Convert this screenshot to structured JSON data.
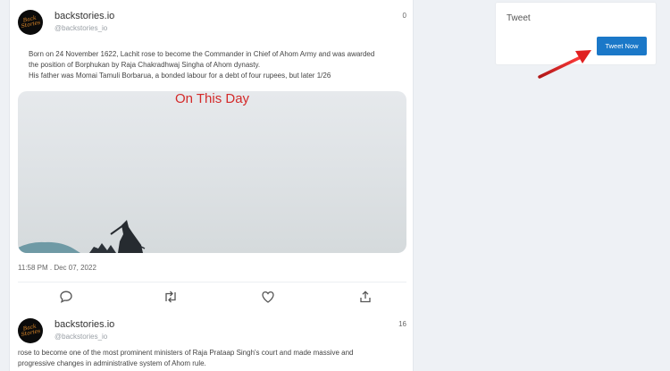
{
  "feed": {
    "tweets": [
      {
        "name": "backstories.io",
        "handle": "@backstories_io",
        "count": "0",
        "avatar_text": "Back Stories",
        "body_line1": "Born on 24 November 1622, Lachit rose to become the Commander in Chief of Ahom Army and was awarded",
        "body_line2": "the position of Borphukan by Raja Chakradhwaj Singha of Ahom dynasty.",
        "body_line3": "His father was Momai Tamuli Borbarua, a bonded labour for a debt of four rupees, but later 1/26",
        "media_overlay": "On This Day",
        "timestamp": "11:58 PM . Dec 07, 2022"
      },
      {
        "name": "backstories.io",
        "handle": "@backstories_io",
        "count": "16",
        "avatar_text": "Back Stories",
        "body_line1": "rose to become one of the most prominent ministers of Raja Prataap Singh's court and made massive and",
        "body_line2": "progressive changes in administrative system of Ahom rule."
      }
    ]
  },
  "actions": {
    "icons": [
      "comment-icon",
      "retweet-icon",
      "like-icon",
      "share-icon"
    ]
  },
  "sidebar": {
    "card_title": "Tweet",
    "button_label": "Tweet Now"
  },
  "colors": {
    "accent": "#1b78c8",
    "overlay_text": "#d42a2a",
    "annotation_arrow": "#e02020"
  }
}
